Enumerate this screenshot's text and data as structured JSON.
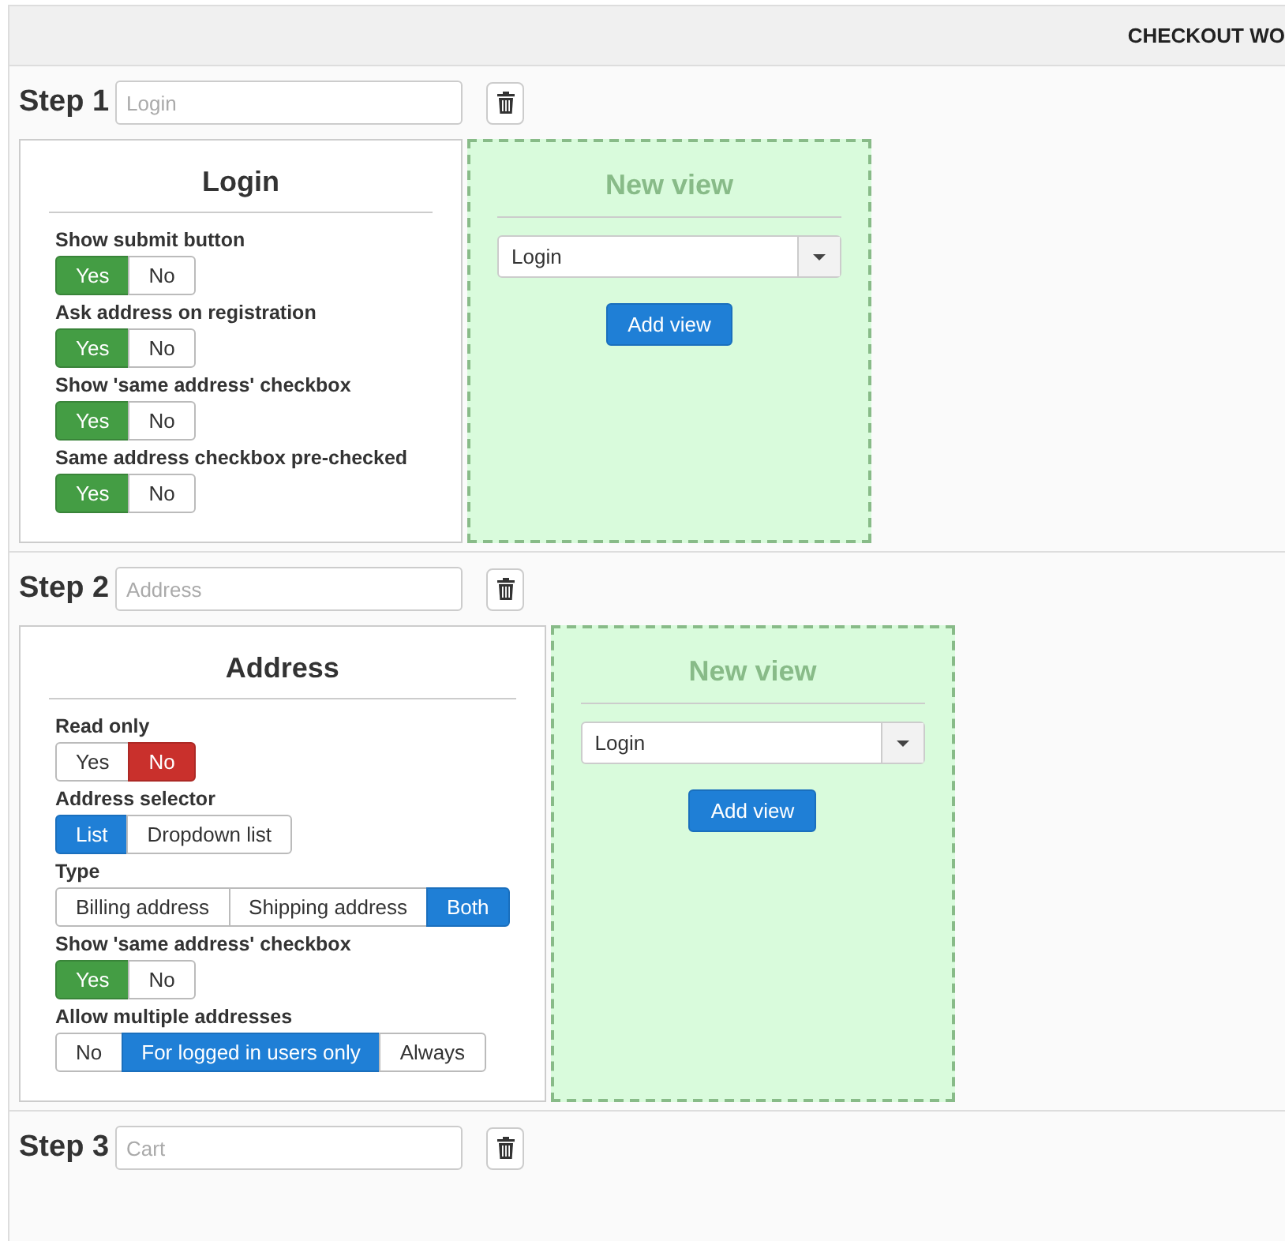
{
  "header": {
    "title": "CHECKOUT WO"
  },
  "steps": [
    {
      "label": "Step 1",
      "name_placeholder": "Login",
      "view": {
        "title": "Login",
        "settings": [
          {
            "label": "Show submit button",
            "kind": "success",
            "options": [
              {
                "label": "Yes",
                "selected": true
              },
              {
                "label": "No",
                "selected": false
              }
            ]
          },
          {
            "label": "Ask address on registration",
            "kind": "success",
            "options": [
              {
                "label": "Yes",
                "selected": true
              },
              {
                "label": "No",
                "selected": false
              }
            ]
          },
          {
            "label": "Show 'same address' checkbox",
            "kind": "success",
            "options": [
              {
                "label": "Yes",
                "selected": true
              },
              {
                "label": "No",
                "selected": false
              }
            ]
          },
          {
            "label": "Same address checkbox pre-checked",
            "kind": "success",
            "options": [
              {
                "label": "Yes",
                "selected": true
              },
              {
                "label": "No",
                "selected": false
              }
            ]
          }
        ]
      },
      "new_view": {
        "title": "New view",
        "select_value": "Login",
        "button": "Add view"
      }
    },
    {
      "label": "Step 2",
      "name_placeholder": "Address",
      "view": {
        "title": "Address",
        "settings": [
          {
            "label": "Read only",
            "kind": "danger",
            "options": [
              {
                "label": "Yes",
                "selected": false
              },
              {
                "label": "No",
                "selected": true
              }
            ]
          },
          {
            "label": "Address selector",
            "kind": "primary",
            "options": [
              {
                "label": "List",
                "selected": true
              },
              {
                "label": "Dropdown list",
                "selected": false
              }
            ]
          },
          {
            "label": "Type",
            "kind": "primary",
            "options": [
              {
                "label": "Billing address",
                "selected": false
              },
              {
                "label": "Shipping address",
                "selected": false
              },
              {
                "label": "Both",
                "selected": true
              }
            ]
          },
          {
            "label": "Show 'same address' checkbox",
            "kind": "success",
            "options": [
              {
                "label": "Yes",
                "selected": true
              },
              {
                "label": "No",
                "selected": false
              }
            ]
          },
          {
            "label": "Allow multiple addresses",
            "kind": "primary",
            "options": [
              {
                "label": "No",
                "selected": false
              },
              {
                "label": "For logged in users only",
                "selected": true
              },
              {
                "label": "Always",
                "selected": false
              }
            ]
          }
        ]
      },
      "new_view": {
        "title": "New view",
        "select_value": "Login",
        "button": "Add view"
      }
    },
    {
      "label": "Step 3",
      "name_placeholder": "Cart"
    }
  ]
}
